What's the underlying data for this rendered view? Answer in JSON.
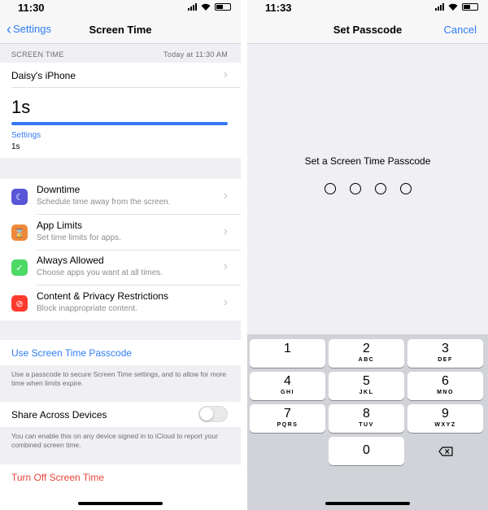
{
  "left": {
    "status": {
      "time": "11:30"
    },
    "nav": {
      "back_label": "Settings",
      "title": "Screen Time"
    },
    "header": {
      "section": "SCREEN TIME",
      "timestamp": "Today at 11:30 AM"
    },
    "device": {
      "name": "Daisy's iPhone"
    },
    "usage": {
      "total": "1s",
      "category": "Settings",
      "category_value": "1s",
      "fill_percent": 100
    },
    "features": [
      {
        "title": "Downtime",
        "subtitle": "Schedule time away from the screen.",
        "icon": "downtime-moon-icon",
        "color": "#5856d6"
      },
      {
        "title": "App Limits",
        "subtitle": "Set time limits for apps.",
        "icon": "hourglass-icon",
        "color": "#f0883a"
      },
      {
        "title": "Always Allowed",
        "subtitle": "Choose apps you want at all times.",
        "icon": "checkmark-badge-icon",
        "color": "#4cd964"
      },
      {
        "title": "Content & Privacy Restrictions",
        "subtitle": "Block inappropriate content.",
        "icon": "no-entry-icon",
        "color": "#ff3b30"
      }
    ],
    "passcode": {
      "link": "Use Screen Time Passcode",
      "note": "Use a passcode to secure Screen Time settings, and to allow for more time when limits expire."
    },
    "share": {
      "label": "Share Across Devices",
      "enabled": false,
      "note": "You can enable this on any device signed in to iCloud to report your combined screen time."
    },
    "turn_off": "Turn Off Screen Time"
  },
  "right": {
    "status": {
      "time": "11:33"
    },
    "nav": {
      "title": "Set Passcode",
      "cancel": "Cancel"
    },
    "prompt": "Set a Screen Time Passcode",
    "keys": [
      {
        "num": "1",
        "letters": ""
      },
      {
        "num": "2",
        "letters": "ABC"
      },
      {
        "num": "3",
        "letters": "DEF"
      },
      {
        "num": "4",
        "letters": "GHI"
      },
      {
        "num": "5",
        "letters": "JKL"
      },
      {
        "num": "6",
        "letters": "MNO"
      },
      {
        "num": "7",
        "letters": "PQRS"
      },
      {
        "num": "8",
        "letters": "TUV"
      },
      {
        "num": "9",
        "letters": "WXYZ"
      },
      {
        "num": "0",
        "letters": ""
      }
    ]
  },
  "colors": {
    "accent": "#2f7cf6",
    "destructive": "#e8443a"
  }
}
